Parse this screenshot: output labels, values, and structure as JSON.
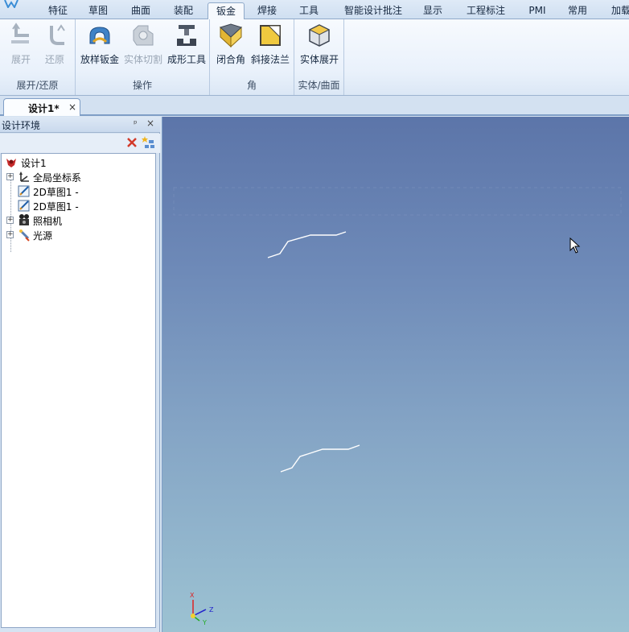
{
  "ribbon_tabs": [
    {
      "label": "特征"
    },
    {
      "label": "草图"
    },
    {
      "label": "曲面"
    },
    {
      "label": "装配"
    },
    {
      "label": "钣金"
    },
    {
      "label": "焊接"
    },
    {
      "label": "工具"
    },
    {
      "label": "智能设计批注"
    },
    {
      "label": "显示"
    },
    {
      "label": "工程标注"
    },
    {
      "label": "PMI"
    },
    {
      "label": "常用"
    },
    {
      "label": "加载"
    }
  ],
  "active_tab": "钣金",
  "ribbon": {
    "groups": [
      {
        "label": "展开/还原",
        "buttons": [
          {
            "label": "展开",
            "icon": "unfold-icon",
            "enabled": false
          },
          {
            "label": "还原",
            "icon": "refold-icon",
            "enabled": false
          }
        ]
      },
      {
        "label": "操作",
        "buttons": [
          {
            "label": "放样钣金",
            "icon": "loft-sheet-icon",
            "enabled": true
          },
          {
            "label": "实体切割",
            "icon": "solid-cut-icon",
            "enabled": false
          },
          {
            "label": "成形工具",
            "icon": "forming-tool-icon",
            "enabled": true
          }
        ]
      },
      {
        "label": "角",
        "buttons": [
          {
            "label": "闭合角",
            "icon": "closed-corner-icon",
            "enabled": true
          },
          {
            "label": "斜接法兰",
            "icon": "miter-flange-icon",
            "enabled": true
          }
        ]
      },
      {
        "label": "实体/曲面",
        "buttons": [
          {
            "label": "实体展开",
            "icon": "solid-unfold-icon",
            "enabled": true
          }
        ]
      }
    ]
  },
  "document_tab": {
    "label": "设计1*",
    "close": "×"
  },
  "design_panel": {
    "title": "设计环境",
    "pin": "ᵖ",
    "close": "×",
    "tree": [
      {
        "label": "设计1",
        "icon": "design-root-icon",
        "expandable": false
      },
      {
        "label": "全局坐标系",
        "icon": "coordinate-system-icon",
        "expandable": true
      },
      {
        "label": "2D草图1 -",
        "icon": "sketch-icon",
        "expandable": false
      },
      {
        "label": "2D草图1 -",
        "icon": "sketch-icon",
        "expandable": false
      },
      {
        "label": "照相机",
        "icon": "camera-icon",
        "expandable": true
      },
      {
        "label": "光源",
        "icon": "light-icon",
        "expandable": true
      }
    ]
  },
  "viewport": {
    "background_top": "#5c75a9",
    "background_bottom": "#9cc2d2",
    "axis_labels": {
      "x": "X",
      "y": "Y",
      "z": "Z"
    }
  },
  "colors": {
    "accent": "#8fa9c9",
    "panel": "#d6e3f2"
  }
}
